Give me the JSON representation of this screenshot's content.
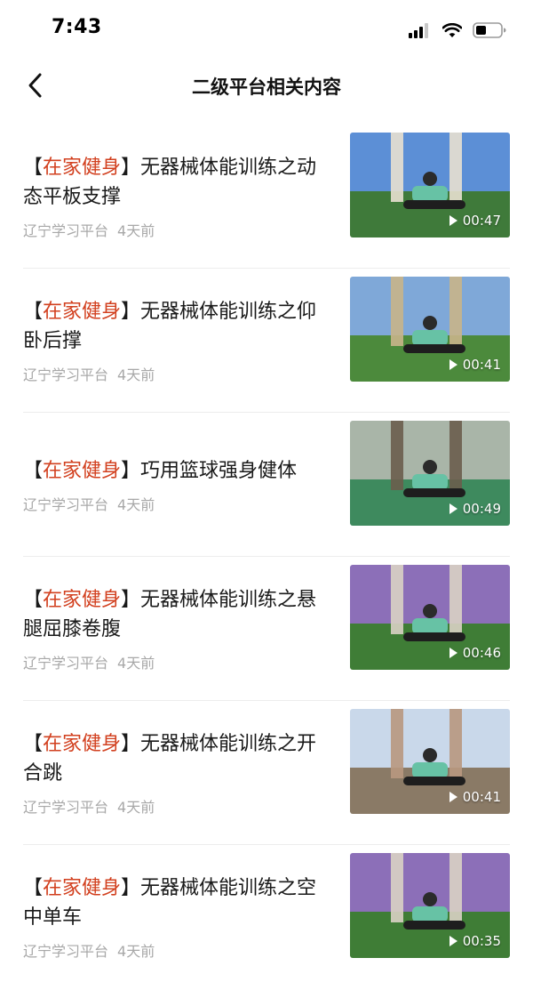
{
  "status_bar": {
    "time": "7:43",
    "icons": [
      "signal-icon",
      "wifi-icon",
      "battery-icon"
    ]
  },
  "nav": {
    "title": "二级平台相关内容",
    "back_icon": "chevron-left-icon"
  },
  "colors": {
    "tag": "#d2401f",
    "meta": "#a8a8a8",
    "title": "#1a1a1a",
    "divider": "#ededed"
  },
  "items": [
    {
      "tag_open": "【",
      "tag": "在家健身",
      "tag_close": "】",
      "title": "无器械体能训练之动态平板支撑",
      "source": "辽宁学习平台",
      "time": "4天前",
      "duration": "00:47",
      "thumb_palette": [
        "#5c8fd6",
        "#3f7a3a",
        "#e8e0d0"
      ]
    },
    {
      "tag_open": "【",
      "tag": "在家健身",
      "tag_close": "】",
      "title": "无器械体能训练之仰卧后撑",
      "source": "辽宁学习平台",
      "time": "4天前",
      "duration": "00:41",
      "thumb_palette": [
        "#7fa8d8",
        "#4c8a3c",
        "#c9b48a"
      ]
    },
    {
      "tag_open": "【",
      "tag": "在家健身",
      "tag_close": "】",
      "title": "巧用篮球强身健体",
      "source": "辽宁学习平台",
      "time": "4天前",
      "duration": "00:49",
      "thumb_palette": [
        "#a9b5a8",
        "#3e8a5e",
        "#6a5d4c"
      ]
    },
    {
      "tag_open": "【",
      "tag": "在家健身",
      "tag_close": "】",
      "title": "无器械体能训练之悬腿屈膝卷腹",
      "source": "辽宁学习平台",
      "time": "4天前",
      "duration": "00:46",
      "thumb_palette": [
        "#8c6fb8",
        "#3f7d36",
        "#d9d2c4"
      ]
    },
    {
      "tag_open": "【",
      "tag": "在家健身",
      "tag_close": "】",
      "title": "无器械体能训练之开合跳",
      "source": "辽宁学习平台",
      "time": "4天前",
      "duration": "00:41",
      "thumb_palette": [
        "#c9d8ea",
        "#8a7a66",
        "#b89880"
      ]
    },
    {
      "tag_open": "【",
      "tag": "在家健身",
      "tag_close": "】",
      "title": "无器械体能训练之空中单车",
      "source": "辽宁学习平台",
      "time": "4天前",
      "duration": "00:35",
      "thumb_palette": [
        "#8c6fb8",
        "#3f7d36",
        "#d9d2c4"
      ]
    }
  ]
}
